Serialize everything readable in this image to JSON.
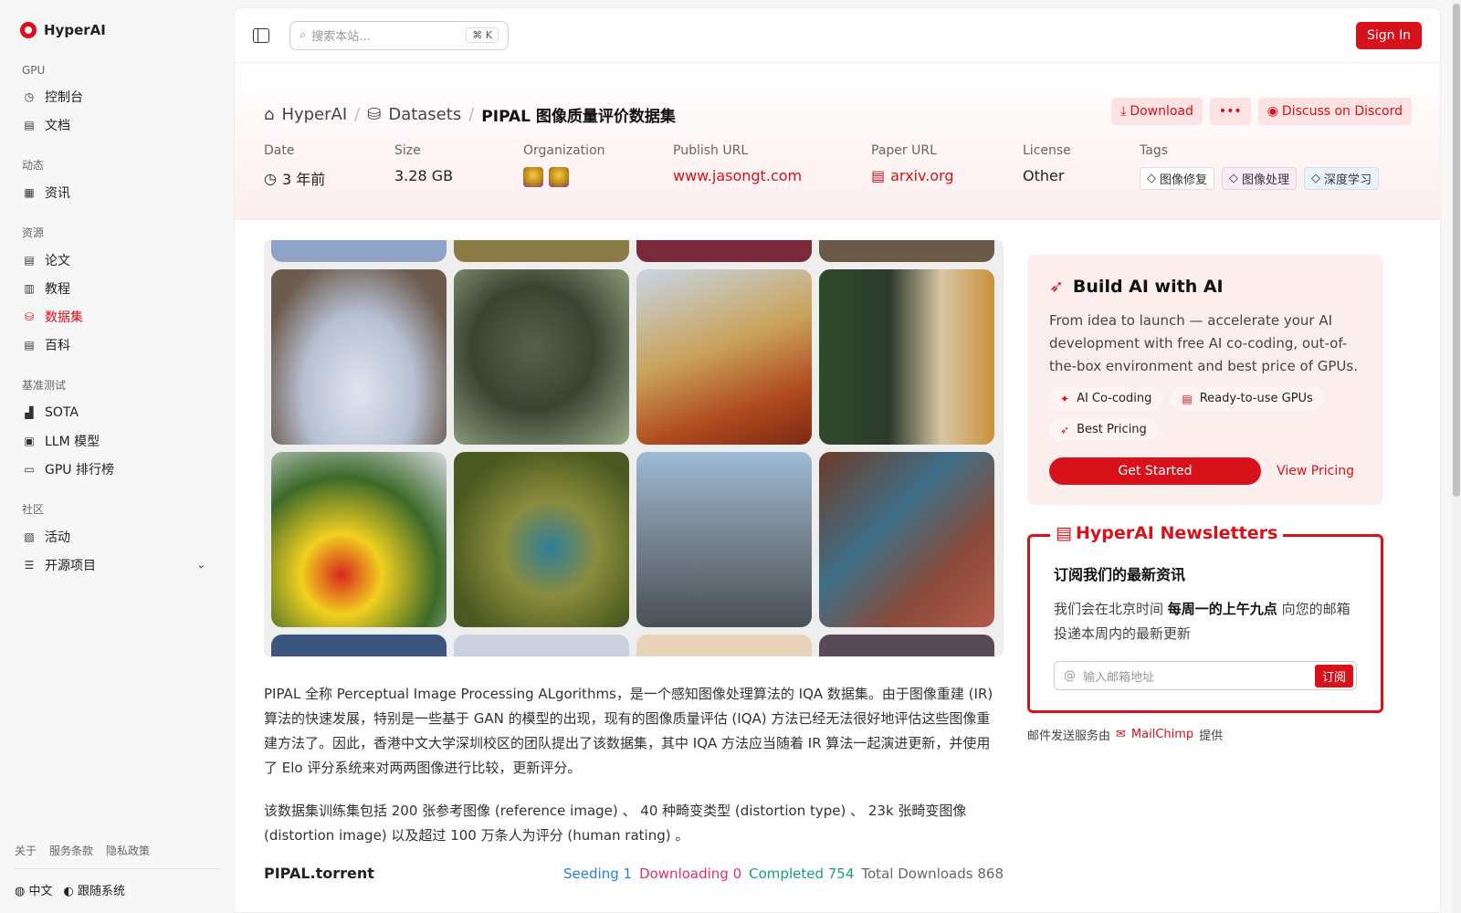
{
  "brand": {
    "name": "HyperAI"
  },
  "sidebar": {
    "sections": [
      {
        "title": "GPU",
        "items": [
          {
            "label": "控制台",
            "icon": "gauge-icon"
          },
          {
            "label": "文档",
            "icon": "doc-icon"
          }
        ]
      },
      {
        "title": "动态",
        "items": [
          {
            "label": "资讯",
            "icon": "news-icon"
          }
        ]
      },
      {
        "title": "资源",
        "items": [
          {
            "label": "论文",
            "icon": "paper-icon"
          },
          {
            "label": "教程",
            "icon": "book-icon"
          },
          {
            "label": "数据集",
            "icon": "database-icon",
            "active": true
          },
          {
            "label": "百科",
            "icon": "wiki-icon"
          }
        ]
      },
      {
        "title": "基准测试",
        "items": [
          {
            "label": "SOTA",
            "icon": "chart-icon"
          },
          {
            "label": "LLM 模型",
            "icon": "chip-icon"
          },
          {
            "label": "GPU 排行榜",
            "icon": "monitor-icon"
          }
        ]
      },
      {
        "title": "社区",
        "items": [
          {
            "label": "活动",
            "icon": "event-icon"
          },
          {
            "label": "开源项目",
            "icon": "list-icon",
            "has_chevron": true
          }
        ]
      }
    ],
    "footer_links": [
      "关于",
      "服务条款",
      "隐私政策"
    ],
    "language": "中文",
    "theme": "跟随系统"
  },
  "topbar": {
    "search_placeholder": "搜索本站...",
    "search_shortcut": "⌘ K",
    "sign_in": "Sign In"
  },
  "breadcrumb": {
    "home": "HyperAI",
    "section": "Datasets",
    "current": "PIPAL 图像质量评价数据集"
  },
  "actions": {
    "download": "Download",
    "more": "•••",
    "discord": "Discuss on Discord"
  },
  "meta": {
    "date_label": "Date",
    "date_value": "3 年前",
    "size_label": "Size",
    "size_value": "3.28 GB",
    "org_label": "Organization",
    "publish_label": "Publish URL",
    "publish_value": "www.jasongt.com",
    "paper_label": "Paper URL",
    "paper_value": "arxiv.org",
    "license_label": "License",
    "license_value": "Other",
    "tags_label": "Tags",
    "tags": [
      "图像修复",
      "图像处理",
      "深度学习"
    ]
  },
  "description": [
    "PIPAL 全称 Perceptual Image Processing ALgorithms，是一个感知图像处理算法的 IQA 数据集。由于图像重建 (IR) 算法的快速发展，特别是一些基于 GAN 的模型的出现，现有的图像质量评估 (IQA) 方法已经无法很好地评估这些图像重建方法了。因此，香港中文大学深圳校区的团队提出了该数据集，其中 IQA 方法应当随着 IR 算法一起演进更新，并使用了 Elo 评分系统来对两两图像进行比较，更新评分。",
    "该数据集训练集包括 200 张参考图像 (reference image) 、 40 种畸变类型 (distortion type) 、 23k 张畸变图像 (distortion image) 以及超过 100 万条人为评分 (human rating) 。"
  ],
  "torrent": {
    "name": "PIPAL.torrent",
    "seeding_label": "Seeding",
    "seeding": "1",
    "downloading_label": "Downloading",
    "downloading": "0",
    "completed_label": "Completed",
    "completed": "754",
    "total_label": "Total Downloads",
    "total": "868"
  },
  "ai_card": {
    "title": "Build AI with AI",
    "description": "From idea to launch — accelerate your AI development with free AI co-coding, out-of-the-box environment and best price of GPUs.",
    "chips": [
      "AI Co-coding",
      "Ready-to-use GPUs",
      "Best Pricing"
    ],
    "get_started": "Get Started",
    "view_pricing": "View Pricing"
  },
  "newsletter": {
    "title": "HyperAI Newsletters",
    "subtitle": "订阅我们的最新资讯",
    "desc_pre": "我们会在北京时间",
    "desc_bold": "每周一的上午九点",
    "desc_post": "向您的邮箱投递本周内的最新更新",
    "email_placeholder": "输入邮箱地址",
    "subscribe": "订阅",
    "provider_pre": "邮件发送服务由",
    "provider_name": "MailChimp",
    "provider_post": "提供"
  },
  "colors": {
    "accent": "#d8121a"
  }
}
